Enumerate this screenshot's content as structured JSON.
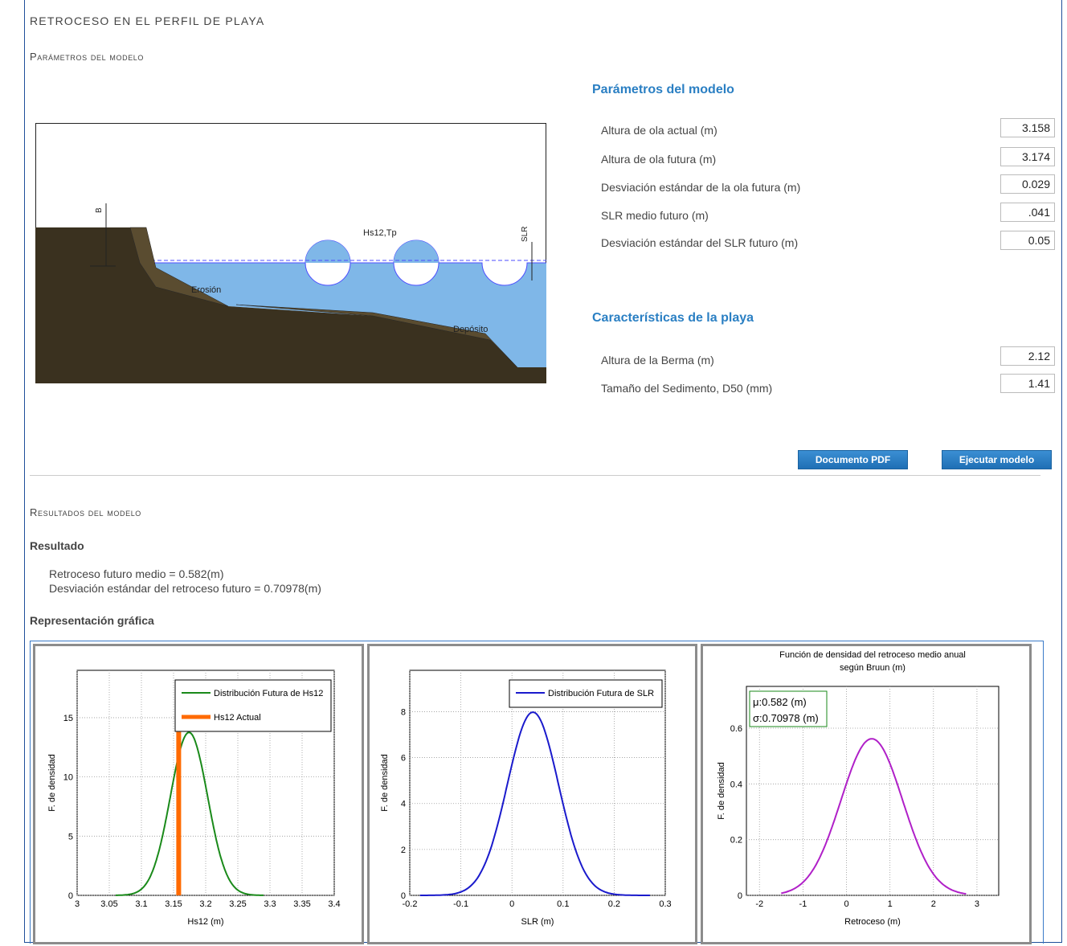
{
  "page": {
    "title": "RETROCESO EN EL PERFIL DE PLAYA",
    "section_params": "Parámetros del modelo",
    "section_results": "Resultados del modelo"
  },
  "diagram": {
    "labels": {
      "b": "B",
      "hs": "Hs12,Tp",
      "slr": "SLR",
      "erosion": "Erosión",
      "deposito": "Depósito"
    },
    "colors": {
      "sand": "#3a311f",
      "water": "#7fb7e8",
      "water_line": "#4d4dff"
    }
  },
  "params": {
    "heading": "Parámetros del modelo",
    "fields": [
      {
        "label": "Altura de ola actual (m)",
        "value": "3.158"
      },
      {
        "label": "Altura de ola futura (m)",
        "value": "3.174"
      },
      {
        "label": "Desviación estándar de la ola futura (m)",
        "value": "0.029"
      },
      {
        "label": "SLR medio futuro (m)",
        "value": ".041"
      },
      {
        "label": "Desviación estándar del SLR futuro (m)",
        "value": "0.05"
      }
    ]
  },
  "beach": {
    "heading": "Características de la playa",
    "fields": [
      {
        "label": "Altura de la Berma (m)",
        "value": "2.12"
      },
      {
        "label": "Tamaño del Sedimento, D50 (mm)",
        "value": "1.41"
      }
    ]
  },
  "buttons": {
    "pdf": "Documento PDF",
    "run": "Ejecutar modelo"
  },
  "results": {
    "heading": "Resultado",
    "line1": "Retroceso futuro medio = 0.582(m)",
    "line2": "Desviación estándar del retroceso futuro = 0.70978(m)",
    "graph_heading": "Representación gráfica"
  },
  "colors": {
    "accent": "#2a7fc3",
    "button": "#2a7fc3"
  },
  "chart_data": [
    {
      "type": "line",
      "xlabel": "Hs12 (m)",
      "ylabel": "F. de densidad",
      "xlim": [
        3,
        3.4
      ],
      "ylim": [
        0,
        19
      ],
      "xticks": [
        "3",
        "3.05",
        "3.1",
        "3.15",
        "3.2",
        "3.25",
        "3.3",
        "3.35",
        "3.4"
      ],
      "yticks": [
        "0",
        "5",
        "10",
        "15"
      ],
      "grid": true,
      "legend_placement": "top-right",
      "legend": [
        "Distribución Futura de Hs12",
        "Hs12 Actual"
      ],
      "series": [
        {
          "name": "Distribución Futura de Hs12",
          "dist": "normal",
          "mean": 3.174,
          "std": 0.029,
          "range": [
            3.06,
            3.29
          ],
          "color": "#1a8a1a"
        },
        {
          "name": "Hs12 Actual",
          "kind": "vline",
          "x": 3.158,
          "ymax": 13.8,
          "color": "#ff6a00"
        }
      ]
    },
    {
      "type": "line",
      "xlabel": "SLR (m)",
      "ylabel": "F. de densidad",
      "xlim": [
        -0.2,
        0.3
      ],
      "ylim": [
        0,
        9.8
      ],
      "xticks": [
        "-0.2",
        "-0.1",
        "0",
        "0.1",
        "0.2",
        "0.3"
      ],
      "yticks": [
        "0",
        "2",
        "4",
        "6",
        "8"
      ],
      "grid": true,
      "legend_placement": "top-right",
      "legend": [
        "Distribución Futura de SLR"
      ],
      "series": [
        {
          "name": "Distribución Futura de SLR",
          "dist": "normal",
          "mean": 0.041,
          "std": 0.05,
          "range": [
            -0.18,
            0.27
          ],
          "color": "#1a1acc"
        }
      ]
    },
    {
      "type": "line",
      "title": "Función de densidad del retroceso medio anual",
      "subtitle": "según Bruun (m)",
      "xlabel": "Retroceso (m)",
      "ylabel": "F. de densidad",
      "xlim": [
        -2.3,
        3.5
      ],
      "ylim": [
        0,
        0.75
      ],
      "xticks": [
        "-2",
        "-1",
        "0",
        "1",
        "2",
        "3"
      ],
      "yticks": [
        "0",
        "0.2",
        "0.4",
        "0.6"
      ],
      "grid": true,
      "annotation": [
        "μ:0.582 (m)",
        "σ:0.70978 (m)"
      ],
      "series": [
        {
          "name": "",
          "dist": "normal",
          "mean": 0.582,
          "std": 0.70978,
          "range": [
            -1.5,
            2.75
          ],
          "color": "#b020c8"
        }
      ]
    }
  ]
}
